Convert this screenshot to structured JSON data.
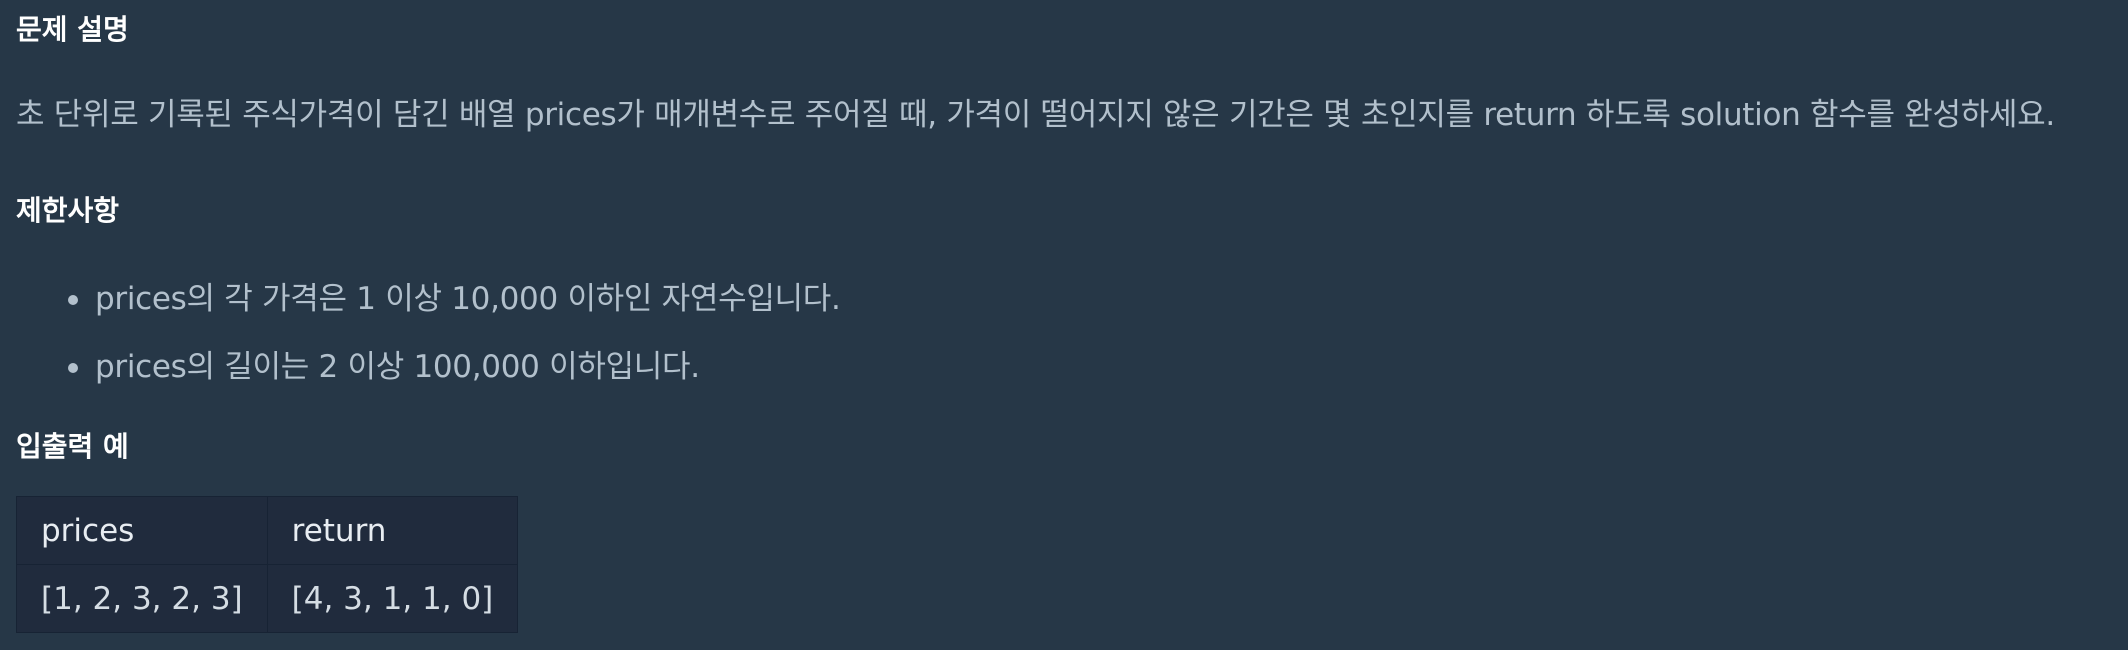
{
  "sections": {
    "description_title": "문제 설명",
    "constraints_title": "제한사항",
    "examples_title": "입출력 예"
  },
  "description": {
    "text": "초 단위로 기록된 주식가격이 담긴 배열 prices가 매개변수로 주어질 때, 가격이 떨어지지 않은 기간은 몇 초인지를 return 하도록 solution 함수를 완성하세요."
  },
  "constraints": [
    "prices의 각 가격은 1 이상 10,000 이하인 자연수입니다.",
    "prices의 길이는 2 이상 100,000 이하입니다."
  ],
  "examples_table": {
    "headers": [
      "prices",
      "return"
    ],
    "rows": [
      [
        "[1, 2, 3, 2, 3]",
        "[4, 3, 1, 1, 0]"
      ]
    ]
  },
  "colors": {
    "background": "#263747",
    "heading": "#ffffff",
    "body_text": "#b2c0cc",
    "table_background": "#202b3d"
  }
}
